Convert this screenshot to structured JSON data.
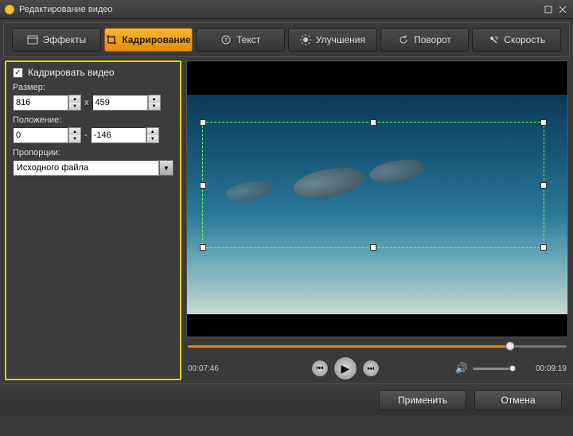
{
  "window": {
    "title": "Редактирование видео"
  },
  "tabs": {
    "effects": {
      "label": "Эффекты"
    },
    "crop": {
      "label": "Кадрирование"
    },
    "text": {
      "label": "Текст"
    },
    "enhance": {
      "label": "Улучшения"
    },
    "rotate": {
      "label": "Поворот"
    },
    "speed": {
      "label": "Скорость"
    }
  },
  "panel": {
    "enable_label": "Кадрировать видео",
    "enable_checked": true,
    "size_label": "Размер:",
    "size_w": "816",
    "size_h": "459",
    "size_sep": "x",
    "pos_label": "Положение:",
    "pos_x": "0",
    "pos_y": "-146",
    "pos_sep": "-",
    "ratio_label": "Пропорции:",
    "ratio_value": "Исходного файла"
  },
  "timeline": {
    "current": "00:07:46",
    "total": "00:09:19",
    "progress_pct": 85
  },
  "footer": {
    "apply": "Применить",
    "cancel": "Отмена"
  },
  "colors": {
    "accent": "#e68a00",
    "highlight_border": "#e3d200"
  }
}
